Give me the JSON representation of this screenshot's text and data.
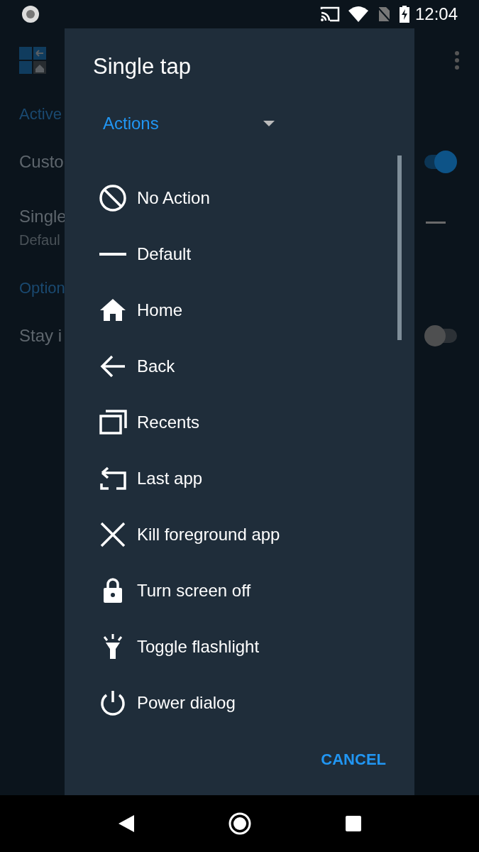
{
  "status_bar": {
    "time": "12:04"
  },
  "background": {
    "sections": [
      {
        "header": "Active",
        "rows": [
          {
            "kind": "toggle",
            "title": "Custo",
            "on": true
          },
          {
            "kind": "value",
            "title": "Single",
            "subtitle": "Defaul"
          }
        ]
      },
      {
        "header": "Option",
        "rows": [
          {
            "kind": "toggle",
            "title": "Stay i",
            "on": false
          }
        ]
      }
    ]
  },
  "dialog": {
    "title": "Single tap",
    "dropdown": {
      "value": "Actions"
    },
    "items": [
      {
        "label": "No Action"
      },
      {
        "label": "Default"
      },
      {
        "label": "Home"
      },
      {
        "label": "Back"
      },
      {
        "label": "Recents"
      },
      {
        "label": "Last app"
      },
      {
        "label": "Kill foreground app"
      },
      {
        "label": "Turn screen off"
      },
      {
        "label": "Toggle flashlight"
      },
      {
        "label": "Power dialog"
      }
    ],
    "buttons": [
      "CANCEL"
    ]
  }
}
